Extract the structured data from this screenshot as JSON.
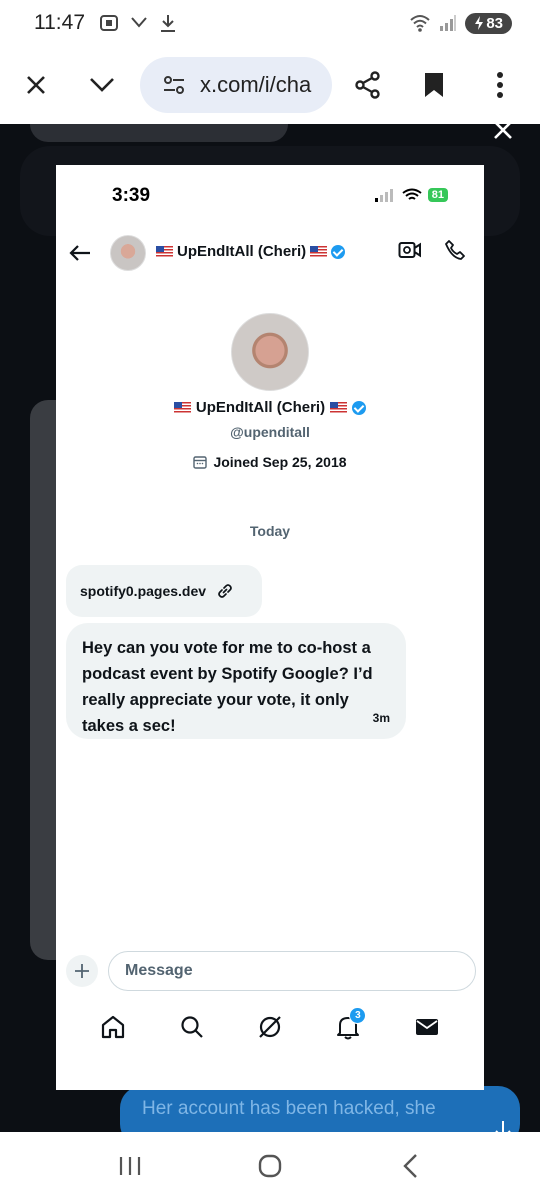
{
  "status_bar": {
    "time": "11:47",
    "battery": "83"
  },
  "browser": {
    "url": "x.com/i/cha"
  },
  "background": {
    "reply_text": "Her account has been hacked, she"
  },
  "screenshot": {
    "ios_time": "3:39",
    "ios_battery": "81",
    "header": {
      "name": "UpEndItAll (Cheri)"
    },
    "profile": {
      "name": "UpEndItAll (Cheri)",
      "handle": "@upenditall",
      "joined": "Joined Sep 25, 2018"
    },
    "date_separator": "Today",
    "messages": [
      {
        "type": "link",
        "text": "spotify0.pages.dev"
      },
      {
        "type": "text",
        "text": "Hey can you vote for me to co-host a podcast event by Spotify Google? I’d really appreciate your vote, it only takes a sec!",
        "time": "3m"
      }
    ],
    "composer": {
      "placeholder": "Message"
    },
    "tabs": [
      {
        "name": "home",
        "icon": "home-icon"
      },
      {
        "name": "search",
        "icon": "search-icon"
      },
      {
        "name": "grok",
        "icon": "grok-icon"
      },
      {
        "name": "notifications",
        "icon": "bell-icon",
        "badge": "3"
      },
      {
        "name": "messages",
        "icon": "mail-icon"
      }
    ]
  },
  "colors": {
    "accent": "#1d9bf0",
    "bubble": "#eff3f4",
    "text": "#0f1419",
    "secondary": "#536471"
  }
}
